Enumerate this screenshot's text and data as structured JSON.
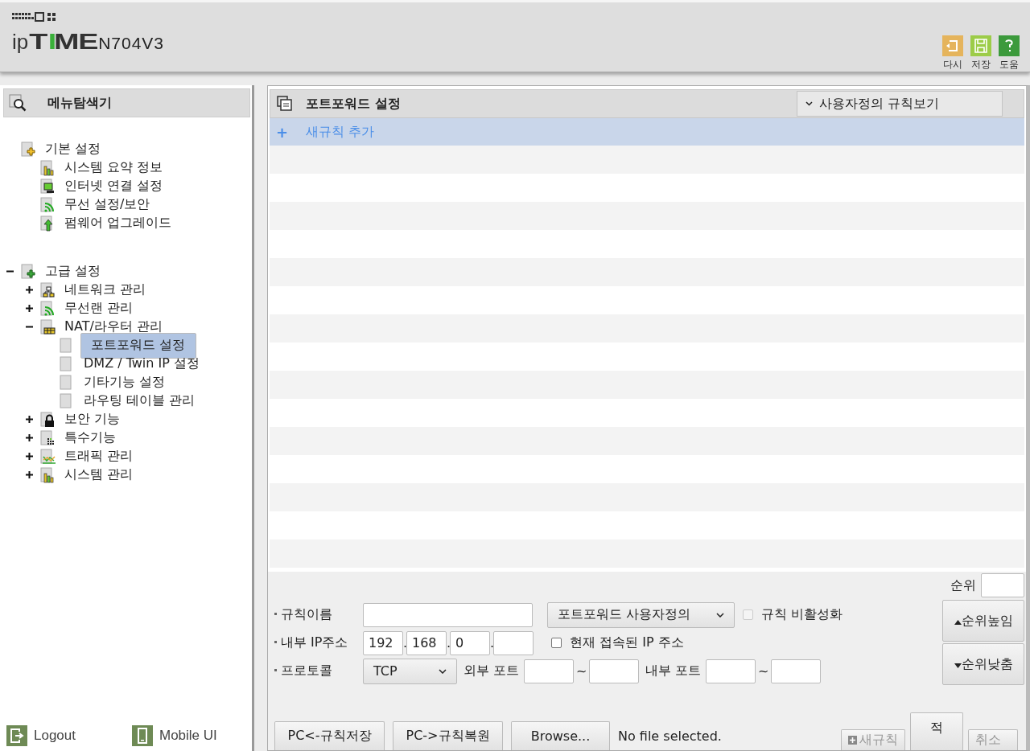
{
  "header": {
    "logo": {
      "prefix": "ip",
      "brand": "TIME",
      "model": "N704V3"
    },
    "tools": [
      {
        "kind": "reload",
        "label": "다시"
      },
      {
        "kind": "save",
        "label": "저장"
      },
      {
        "kind": "help",
        "label": "도움"
      }
    ]
  },
  "sidebar": {
    "title": "메뉴탐색기",
    "tree": [
      {
        "label": "기본 설정",
        "kind": "star-folder",
        "children": [
          {
            "label": "시스템 요약 정보",
            "kind": "chart"
          },
          {
            "label": "인터넷 연결 설정",
            "kind": "monitor"
          },
          {
            "label": "무선 설정/보안",
            "kind": "wifi"
          },
          {
            "label": "펌웨어 업그레이드",
            "kind": "upgrade"
          }
        ]
      },
      {
        "label": "고급 설정",
        "kind": "plus-folder",
        "expanded": true,
        "children": [
          {
            "label": "네트워크 관리",
            "kind": "network",
            "expanded": false
          },
          {
            "label": "무선랜 관리",
            "kind": "wifi",
            "expanded": false
          },
          {
            "label": "NAT/라우터 관리",
            "kind": "router",
            "expanded": true,
            "children": [
              {
                "label": "포트포워드 설정",
                "kind": "page",
                "selected": true
              },
              {
                "label": "DMZ / Twin IP 설정",
                "kind": "page",
                "selected": false
              },
              {
                "label": "기타기능 설정",
                "kind": "page",
                "selected": false
              },
              {
                "label": "라우팅 테이블 관리",
                "kind": "page",
                "selected": false
              }
            ]
          },
          {
            "label": "보안 기능",
            "kind": "lock",
            "expanded": false
          },
          {
            "label": "특수기능",
            "kind": "dots",
            "expanded": false
          },
          {
            "label": "트래픽 관리",
            "kind": "traffic",
            "expanded": false
          },
          {
            "label": "시스템 관리",
            "kind": "chart",
            "expanded": false
          }
        ]
      }
    ],
    "footer": [
      {
        "kind": "logout",
        "label": "Logout"
      },
      {
        "kind": "mobile",
        "label": "Mobile UI"
      }
    ]
  },
  "panel": {
    "title": "포트포워드 설정",
    "view_menu": "사용자정의 규칙보기",
    "add_rule": "+",
    "add_rule_label": "새규칙 추가",
    "form": {
      "order_label": "순위",
      "rule_name_label": "규칙이름",
      "rule_type": "포트포워드 사용자정의",
      "disable_rule": {
        "label": "규칙 비활성화",
        "checked": false,
        "disabled": true
      },
      "ip_label": "내부 IP주소",
      "ip_separator": ".",
      "ip": [
        "192",
        "168",
        "0"
      ],
      "current_ip": {
        "label": "현재 접속된 IP 주소",
        "checked": false,
        "disabled": false
      },
      "protocol_label": "프로토콜",
      "protocol": "TCP",
      "external_port_label": "외부 포트",
      "internal_port_label": "내부 포트",
      "tilde": "~",
      "move_up": "순위높임",
      "move_down": "순위낮춤"
    },
    "bottom": {
      "save_pc": "PC<-규칙저장",
      "restore_pc": "PC->규칙복원",
      "browse": "Browse...",
      "file_status": "No file selected.",
      "new_rule": {
        "label": "새규칙",
        "disabled": true
      },
      "apply": {
        "label": "적",
        "disabled": false
      },
      "cancel": {
        "label": "취소",
        "disabled": true
      }
    }
  }
}
